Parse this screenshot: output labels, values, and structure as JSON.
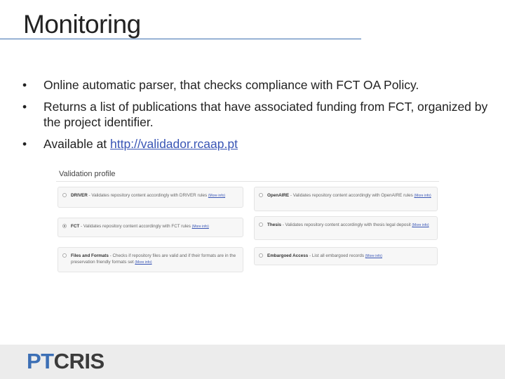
{
  "slide": {
    "title": "Monitoring"
  },
  "bullets": [
    {
      "text": "Online automatic parser, that checks compliance with FCT OA Policy."
    },
    {
      "text": "Returns a list of publications that have associated funding from FCT, organized by the project identifier."
    },
    {
      "text_before": "Available at ",
      "link": "http://validador.rcaap.pt"
    }
  ],
  "bullet_glyph": "•",
  "validation_panel": {
    "title": "Validation profile",
    "options": [
      {
        "name": "DRIVER",
        "desc": " - Validates repository content accordingly with DRIVER rules ",
        "more": "(More info)",
        "selected": false
      },
      {
        "name": "OpenAIRE",
        "desc": " - Validates repository content accordingly with OpenAIRE rules ",
        "more": "(More info)",
        "selected": false
      },
      {
        "name": "FCT",
        "desc": " - Validates repository content accordingly with FCT rules ",
        "more": "(More info)",
        "selected": true
      },
      {
        "name": "Thesis",
        "desc": " - Validates repository content accordingly with thesis legal deposit ",
        "more": "(More info)",
        "selected": false
      },
      {
        "name": "Files and Formats",
        "desc": " - Checks if repository files are valid and if their formats are in the preservation friendly formats set ",
        "more": "(More info)",
        "selected": false
      },
      {
        "name": "Embargoed Access",
        "desc": " - List all embargoed records ",
        "more": "(More info)",
        "selected": false
      }
    ]
  },
  "footer": {
    "logo_part1": "PT",
    "logo_part2": "CRIS"
  },
  "colors": {
    "accent": "#3c6fb5",
    "link": "#3a56b5",
    "footer_bg": "#ececec",
    "logo_dark": "#3b3b3b"
  }
}
